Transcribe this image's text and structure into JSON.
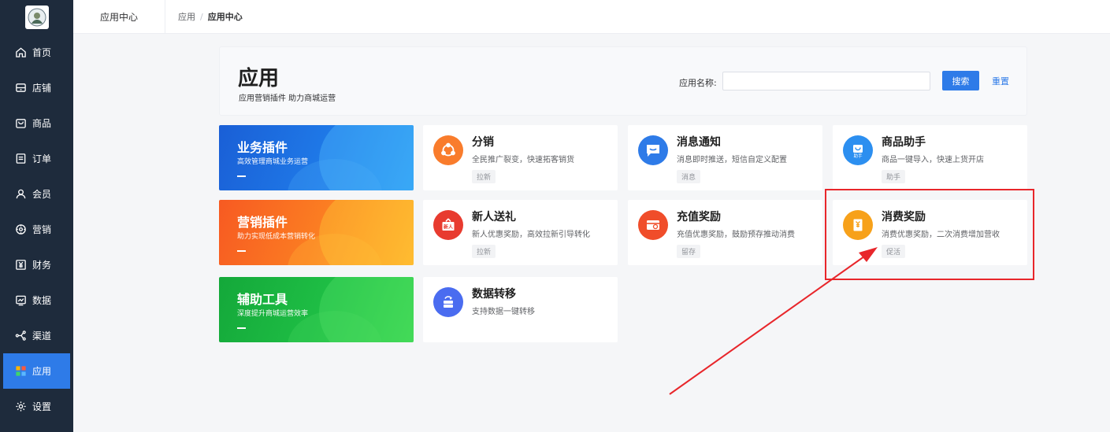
{
  "top_title": "应用中心",
  "breadcrumb": {
    "parent": "应用",
    "separator": "/",
    "current": "应用中心"
  },
  "sidebar": {
    "items": [
      {
        "label": "首页",
        "icon": "home-icon"
      },
      {
        "label": "店铺",
        "icon": "store-icon"
      },
      {
        "label": "商品",
        "icon": "bag-icon"
      },
      {
        "label": "订单",
        "icon": "order-icon"
      },
      {
        "label": "会员",
        "icon": "user-icon"
      },
      {
        "label": "营销",
        "icon": "marketing-icon"
      },
      {
        "label": "财务",
        "icon": "yuan-icon"
      },
      {
        "label": "数据",
        "icon": "chart-icon"
      },
      {
        "label": "渠道",
        "icon": "channel-icon"
      },
      {
        "label": "应用",
        "icon": "apps-icon",
        "active": true
      },
      {
        "label": "设置",
        "icon": "gear-icon"
      }
    ]
  },
  "header": {
    "title": "应用",
    "subtitle": "应用营销插件 助力商城运营",
    "search_label": "应用名称:",
    "search_value": "",
    "search_button": "搜索",
    "reset_link": "重置"
  },
  "categories": [
    {
      "title": "业务插件",
      "subtitle": "高效管理商城业务运营"
    },
    {
      "title": "营销插件",
      "subtitle": "助力实现低成本营销转化"
    },
    {
      "title": "辅助工具",
      "subtitle": "深度提升商城运营效率"
    }
  ],
  "plugins": {
    "fenxiao": {
      "name": "分销",
      "desc": "全民推广裂变，快速拓客销货",
      "tag": "拉新",
      "color": "#f97c2c"
    },
    "message": {
      "name": "消息通知",
      "desc": "消息即时推送，短信自定义配置",
      "tag": "消息",
      "color": "#2e7be8"
    },
    "goods_helper": {
      "name": "商品助手",
      "desc": "商品一键导入，快速上货开店",
      "tag": "助手",
      "icon_text": "助手",
      "color": "#2c8ff0"
    },
    "new_gift": {
      "name": "新人送礼",
      "desc": "新人优惠奖励，高效拉新引导转化",
      "tag": "拉新",
      "icon_text": "新人",
      "color": "#e83b2f"
    },
    "recharge": {
      "name": "充值奖励",
      "desc": "充值优惠奖励，鼓励预存推动消费",
      "tag": "留存",
      "color": "#f04d2a"
    },
    "consume": {
      "name": "消费奖励",
      "desc": "消费优惠奖励，二次消费增加营收",
      "tag": "促活",
      "color": "#f7a11a"
    },
    "migrate": {
      "name": "数据转移",
      "desc": "支持数据一键转移",
      "color": "#4a6cf0"
    }
  }
}
